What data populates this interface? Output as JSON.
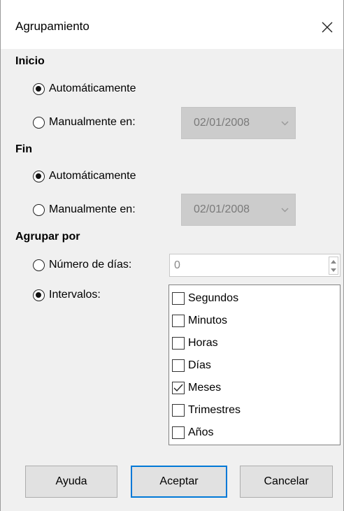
{
  "dialog": {
    "title": "Agrupamiento",
    "close_icon": "close-icon"
  },
  "inicio": {
    "heading": "Inicio",
    "auto_label": "Automáticamente",
    "auto_checked": true,
    "manual_label": "Manualmente en:",
    "manual_checked": false,
    "date_value": "02/01/2008"
  },
  "fin": {
    "heading": "Fin",
    "auto_label": "Automáticamente",
    "auto_checked": true,
    "manual_label": "Manualmente en:",
    "manual_checked": false,
    "date_value": "02/01/2008"
  },
  "agrupar": {
    "heading": "Agrupar por",
    "days_label": "Número de días:",
    "days_checked": false,
    "days_value": "0",
    "intervals_label": "Intervalos:",
    "intervals_checked": true,
    "intervals": [
      {
        "label": "Segundos",
        "checked": false
      },
      {
        "label": "Minutos",
        "checked": false
      },
      {
        "label": "Horas",
        "checked": false
      },
      {
        "label": "Días",
        "checked": false
      },
      {
        "label": "Meses",
        "checked": true
      },
      {
        "label": "Trimestres",
        "checked": false
      },
      {
        "label": "Años",
        "checked": false
      }
    ]
  },
  "buttons": {
    "help": "Ayuda",
    "ok": "Aceptar",
    "cancel": "Cancelar"
  },
  "colors": {
    "accent": "#0078d7",
    "dialog_bg": "#f0f0f0",
    "disabled_field": "#cccccc"
  }
}
